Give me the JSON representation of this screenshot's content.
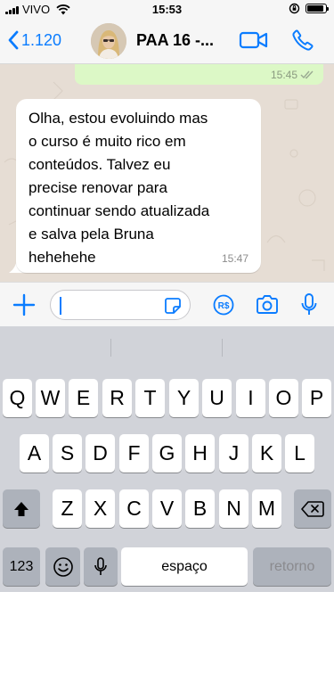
{
  "status_bar": {
    "carrier": "VIVO",
    "time": "15:53",
    "battery_level": 0.9
  },
  "header": {
    "back_label": "1.120",
    "chat_title": "PAA 16 -...",
    "icons": [
      "chevron-left-icon",
      "video-icon",
      "phone-icon"
    ]
  },
  "messages": {
    "outgoing_time": "15:45",
    "incoming_text": "Olha, estou evoluindo mas\no curso é muito rico em\nconteúdos. Talvez eu\nprecise renovar para\ncontinuar sendo atualizada\ne salva pela Bruna\nhehehehe",
    "incoming_time": "15:47"
  },
  "input_bar": {
    "value": "",
    "placeholder": "",
    "icons": [
      "plus-icon",
      "sticker-icon",
      "payment-icon",
      "camera-icon",
      "microphone-icon"
    ]
  },
  "keyboard": {
    "row1": [
      "Q",
      "W",
      "E",
      "R",
      "T",
      "Y",
      "U",
      "I",
      "O",
      "P"
    ],
    "row2": [
      "A",
      "S",
      "D",
      "F",
      "G",
      "H",
      "J",
      "K",
      "L"
    ],
    "row3": [
      "Z",
      "X",
      "C",
      "V",
      "B",
      "N",
      "M"
    ],
    "numbers_label": "123",
    "space_label": "espaço",
    "return_label": "retorno"
  },
  "colors": {
    "accent": "#0a7cff",
    "chat_background": "#e6ddd4",
    "outgoing_bubble": "#dcf8c6",
    "incoming_bubble": "#ffffff",
    "keyboard_background": "#d1d3d9"
  }
}
